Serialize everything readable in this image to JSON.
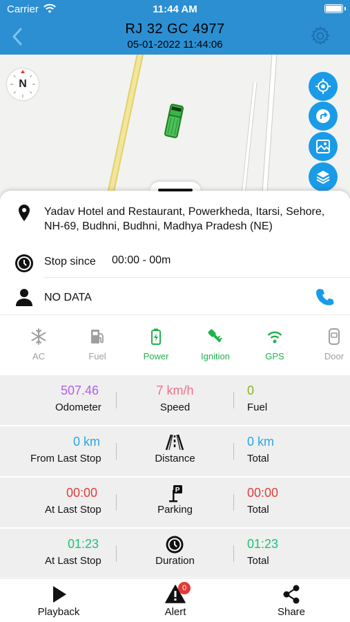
{
  "status_bar": {
    "carrier": "Carrier",
    "time": "11:44 AM"
  },
  "header": {
    "title": "RJ 32 GC 4977",
    "subtitle": "05-01-2022 11:44:06"
  },
  "map": {
    "compass_label": "N"
  },
  "info": {
    "address": "Yadav Hotel and Restaurant, Powerkheda, Itarsi, Sehore, NH-69, Budhni, Budhni, Madhya Pradesh (NE)",
    "stop_label": "Stop since",
    "stop_value": "00:00 - 00m",
    "driver": "NO DATA"
  },
  "sensors": [
    {
      "label": "AC",
      "icon": "snowflake-icon",
      "active": false
    },
    {
      "label": "Fuel",
      "icon": "fuel-pump-icon",
      "active": false
    },
    {
      "label": "Power",
      "icon": "battery-charging-icon",
      "active": true
    },
    {
      "label": "Ignition",
      "icon": "key-icon",
      "active": true
    },
    {
      "label": "GPS",
      "icon": "wifi-signal-icon",
      "active": true
    },
    {
      "label": "Door",
      "icon": "car-door-icon",
      "active": false
    }
  ],
  "stats": {
    "odometer": {
      "value": "507.46",
      "label": "Odometer"
    },
    "speed": {
      "value": "7 km/h",
      "label": "Speed"
    },
    "fuel": {
      "value": "0",
      "label": "Fuel"
    },
    "from_last_stop": {
      "value": "0 km",
      "label": "From Last Stop"
    },
    "distance": {
      "label": "Distance"
    },
    "distance_total": {
      "value": "0 km",
      "label": "Total"
    },
    "at_last_stop_parking": {
      "value": "00:00",
      "label": "At Last Stop"
    },
    "parking": {
      "label": "Parking"
    },
    "parking_total": {
      "value": "00:00",
      "label": "Total"
    },
    "at_last_stop_duration": {
      "value": "01:23",
      "label": "At Last Stop"
    },
    "duration": {
      "label": "Duration"
    },
    "duration_total": {
      "value": "01:23",
      "label": "Total"
    }
  },
  "bottom_nav": {
    "playback": "Playback",
    "alert": "Alert",
    "alert_count": "0",
    "share": "Share"
  },
  "colors": {
    "header": "#2b8fd2",
    "accent_blue": "#1a9be8",
    "active_green": "#22b14c",
    "inactive_grey": "#9e9e9e",
    "odometer_purple": "#b55cf0",
    "speed_pink": "#ef6f8a",
    "fuel_olive": "#8bb31a",
    "distance_blue": "#2aa6e8",
    "parking_red": "#e23c3c",
    "duration_green": "#1fbf77"
  }
}
